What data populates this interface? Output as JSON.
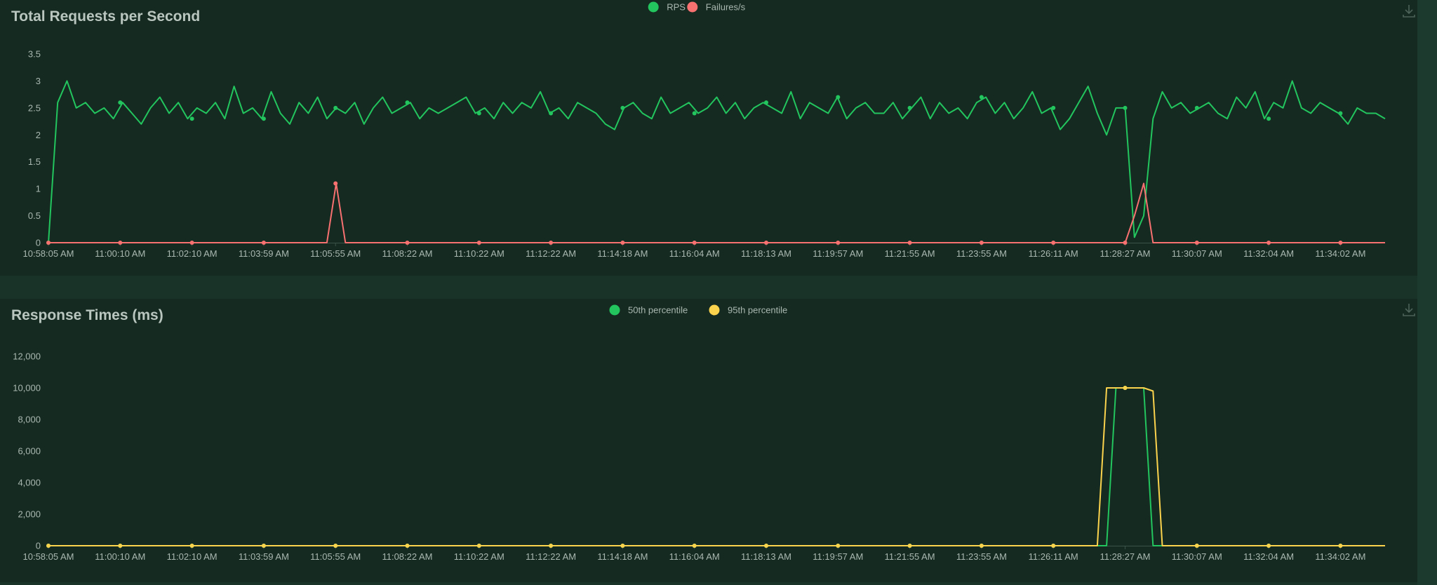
{
  "charts": [
    {
      "id": "rps",
      "title": "Total Requests per Second",
      "legend": [
        {
          "label": "RPS",
          "color": "#22c55e"
        },
        {
          "label": "Failures/s",
          "color": "#f87171"
        }
      ],
      "download_icon": "download-icon"
    },
    {
      "id": "resp",
      "title": "Response Times (ms)",
      "legend": [
        {
          "label": "50th percentile",
          "color": "#22c55e"
        },
        {
          "label": "95th percentile",
          "color": "#fcd34d"
        }
      ],
      "download_icon": "download-icon"
    }
  ],
  "chart_data": [
    {
      "type": "line",
      "title": "Total Requests per Second",
      "x_tick_labels": [
        "10:58:05 AM",
        "11:00:10 AM",
        "11:02:10 AM",
        "11:03:59 AM",
        "11:05:55 AM",
        "11:08:22 AM",
        "11:10:22 AM",
        "11:12:22 AM",
        "11:14:18 AM",
        "11:16:04 AM",
        "11:18:13 AM",
        "11:19:57 AM",
        "11:21:55 AM",
        "11:23:55 AM",
        "11:26:11 AM",
        "11:28:27 AM",
        "11:30:07 AM",
        "11:32:04 AM",
        "11:34:02 AM"
      ],
      "y_ticks": [
        "0",
        "0.5",
        "1",
        "1.5",
        "2",
        "2.5",
        "3",
        "3.5"
      ],
      "ylim": [
        0,
        3.5
      ],
      "grid": false,
      "legend_position": "top-center",
      "series": [
        {
          "name": "RPS",
          "color": "#22c55e",
          "values": [
            0,
            2.6,
            3.0,
            2.5,
            2.6,
            2.4,
            2.5,
            2.3,
            2.6,
            2.4,
            2.2,
            2.5,
            2.7,
            2.4,
            2.6,
            2.3,
            2.5,
            2.4,
            2.6,
            2.3,
            2.9,
            2.4,
            2.5,
            2.3,
            2.8,
            2.4,
            2.2,
            2.6,
            2.4,
            2.7,
            2.3,
            2.5,
            2.4,
            2.6,
            2.2,
            2.5,
            2.7,
            2.4,
            2.5,
            2.6,
            2.3,
            2.5,
            2.4,
            2.5,
            2.6,
            2.7,
            2.4,
            2.5,
            2.3,
            2.6,
            2.4,
            2.6,
            2.5,
            2.8,
            2.4,
            2.5,
            2.3,
            2.6,
            2.5,
            2.4,
            2.2,
            2.1,
            2.5,
            2.6,
            2.4,
            2.3,
            2.7,
            2.4,
            2.5,
            2.6,
            2.4,
            2.5,
            2.7,
            2.4,
            2.6,
            2.3,
            2.5,
            2.6,
            2.5,
            2.4,
            2.8,
            2.3,
            2.6,
            2.5,
            2.4,
            2.7,
            2.3,
            2.5,
            2.6,
            2.4,
            2.4,
            2.6,
            2.3,
            2.5,
            2.7,
            2.3,
            2.6,
            2.4,
            2.5,
            2.3,
            2.6,
            2.7,
            2.4,
            2.6,
            2.3,
            2.5,
            2.8,
            2.4,
            2.5,
            2.1,
            2.3,
            2.6,
            2.9,
            2.4,
            2.0,
            2.5,
            2.5,
            0.1,
            0.5,
            2.3,
            2.8,
            2.5,
            2.6,
            2.4,
            2.5,
            2.6,
            2.4,
            2.3,
            2.7,
            2.5,
            2.8,
            2.3,
            2.6,
            2.5,
            3.0,
            2.5,
            2.4,
            2.6,
            2.5,
            2.4,
            2.2,
            2.5,
            2.4,
            2.4,
            2.3
          ]
        },
        {
          "name": "Failures/s",
          "color": "#f87171",
          "values": [
            0,
            0,
            0,
            0,
            0,
            0,
            0,
            0,
            0,
            0,
            0,
            0,
            0,
            0,
            0,
            0,
            0,
            0,
            0,
            0,
            0,
            0,
            0,
            0,
            0,
            0,
            0,
            0,
            0,
            0,
            0,
            1.1,
            0,
            0,
            0,
            0,
            0,
            0,
            0,
            0,
            0,
            0,
            0,
            0,
            0,
            0,
            0,
            0,
            0,
            0,
            0,
            0,
            0,
            0,
            0,
            0,
            0,
            0,
            0,
            0,
            0,
            0,
            0,
            0,
            0,
            0,
            0,
            0,
            0,
            0,
            0,
            0,
            0,
            0,
            0,
            0,
            0,
            0,
            0,
            0,
            0,
            0,
            0,
            0,
            0,
            0,
            0,
            0,
            0,
            0,
            0,
            0,
            0,
            0,
            0,
            0,
            0,
            0,
            0,
            0,
            0,
            0,
            0,
            0,
            0,
            0,
            0,
            0,
            0,
            0,
            0,
            0,
            0,
            0,
            0,
            0,
            0,
            0.5,
            1.1,
            0,
            0,
            0,
            0,
            0,
            0,
            0,
            0,
            0,
            0,
            0,
            0,
            0,
            0,
            0,
            0,
            0,
            0,
            0,
            0,
            0,
            0,
            0,
            0,
            0,
            0
          ]
        }
      ]
    },
    {
      "type": "line",
      "title": "Response Times (ms)",
      "x_tick_labels": [
        "10:58:05 AM",
        "11:00:10 AM",
        "11:02:10 AM",
        "11:03:59 AM",
        "11:05:55 AM",
        "11:08:22 AM",
        "11:10:22 AM",
        "11:12:22 AM",
        "11:14:18 AM",
        "11:16:04 AM",
        "11:18:13 AM",
        "11:19:57 AM",
        "11:21:55 AM",
        "11:23:55 AM",
        "11:26:11 AM",
        "11:28:27 AM",
        "11:30:07 AM",
        "11:32:04 AM",
        "11:34:02 AM"
      ],
      "y_ticks": [
        "0",
        "2,000",
        "4,000",
        "6,000",
        "8,000",
        "10,000",
        "12,000"
      ],
      "ylim": [
        0,
        12000
      ],
      "grid": false,
      "legend_position": "top-center",
      "series": [
        {
          "name": "50th percentile",
          "color": "#22c55e",
          "values": [
            0,
            0,
            0,
            0,
            0,
            0,
            0,
            0,
            0,
            0,
            0,
            0,
            0,
            0,
            0,
            0,
            0,
            0,
            0,
            0,
            0,
            0,
            0,
            0,
            0,
            0,
            0,
            0,
            0,
            0,
            0,
            0,
            0,
            0,
            0,
            0,
            0,
            0,
            0,
            0,
            0,
            0,
            0,
            0,
            0,
            0,
            0,
            0,
            0,
            0,
            0,
            0,
            0,
            0,
            0,
            0,
            0,
            0,
            0,
            0,
            0,
            0,
            0,
            0,
            0,
            0,
            0,
            0,
            0,
            0,
            0,
            0,
            0,
            0,
            0,
            0,
            0,
            0,
            0,
            0,
            0,
            0,
            0,
            0,
            0,
            0,
            0,
            0,
            0,
            0,
            0,
            0,
            0,
            0,
            0,
            0,
            0,
            0,
            0,
            0,
            0,
            0,
            0,
            0,
            0,
            0,
            0,
            0,
            0,
            0,
            0,
            0,
            0,
            0,
            0,
            10000,
            10000,
            10000,
            10000,
            0,
            0,
            0,
            0,
            0,
            0,
            0,
            0,
            0,
            0,
            0,
            0,
            0,
            0,
            0,
            0,
            0,
            0,
            0,
            0,
            0,
            0,
            0,
            0,
            0,
            0
          ]
        },
        {
          "name": "95th percentile",
          "color": "#fcd34d",
          "values": [
            0,
            0,
            0,
            0,
            0,
            0,
            0,
            0,
            0,
            0,
            0,
            0,
            0,
            0,
            0,
            0,
            0,
            0,
            0,
            0,
            0,
            0,
            0,
            0,
            0,
            0,
            0,
            0,
            0,
            0,
            0,
            0,
            0,
            0,
            0,
            0,
            0,
            0,
            0,
            0,
            0,
            0,
            0,
            0,
            0,
            0,
            0,
            0,
            0,
            0,
            0,
            0,
            0,
            0,
            0,
            0,
            0,
            0,
            0,
            0,
            0,
            0,
            0,
            0,
            0,
            0,
            0,
            0,
            0,
            0,
            0,
            0,
            0,
            0,
            0,
            0,
            0,
            0,
            0,
            0,
            0,
            0,
            0,
            0,
            0,
            0,
            0,
            0,
            0,
            0,
            0,
            0,
            0,
            0,
            0,
            0,
            0,
            0,
            0,
            0,
            0,
            0,
            0,
            0,
            0,
            0,
            0,
            0,
            0,
            0,
            0,
            0,
            0,
            0,
            10000,
            10000,
            10000,
            10000,
            10000,
            9800,
            0,
            0,
            0,
            0,
            0,
            0,
            0,
            0,
            0,
            0,
            0,
            0,
            0,
            0,
            0,
            0,
            0,
            0,
            0,
            0,
            0,
            0,
            0,
            0,
            0
          ]
        }
      ]
    }
  ]
}
